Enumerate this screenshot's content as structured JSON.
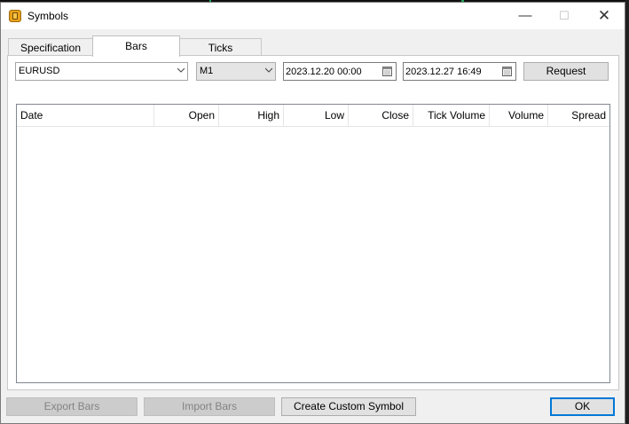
{
  "window": {
    "title": "Symbols",
    "app_icon": "dollar-icon"
  },
  "tabs": [
    {
      "label": "Specification",
      "active": false
    },
    {
      "label": "Bars",
      "active": true
    },
    {
      "label": "Ticks",
      "active": false
    }
  ],
  "filters": {
    "symbol": "EURUSD",
    "timeframe": "M1",
    "date_from": "2023.12.20 00:00",
    "date_to": "2023.12.27 16:49",
    "request_label": "Request"
  },
  "table": {
    "columns": [
      "Date",
      "Open",
      "High",
      "Low",
      "Close",
      "Tick Volume",
      "Volume",
      "Spread"
    ],
    "rows": []
  },
  "footer": {
    "export_label": "Export Bars",
    "import_label": "Import Bars",
    "create_label": "Create Custom Symbol",
    "ok_label": "OK"
  }
}
